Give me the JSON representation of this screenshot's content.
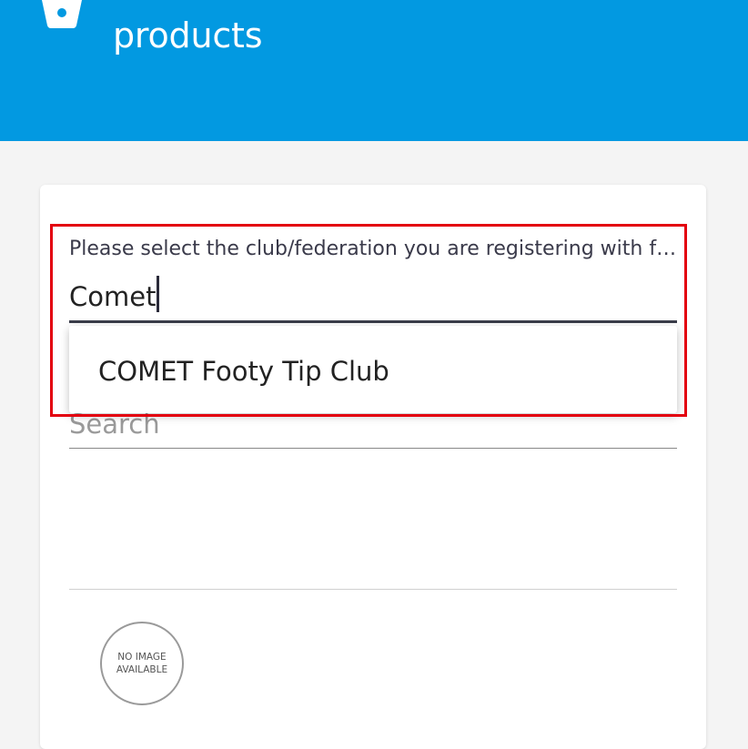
{
  "header": {
    "icon": "basket-icon",
    "title": "products",
    "background_color": "#0299e1"
  },
  "club_select": {
    "label": "Please select the club/federation you are registering with fr...",
    "value": "Comet",
    "options": [
      "COMET Footy Tip Club"
    ]
  },
  "search": {
    "placeholder": "Search"
  },
  "product": {
    "image_placeholder": "NO IMAGE\nAVAILABLE"
  },
  "colors": {
    "highlight": "#e3000f",
    "page_background": "#f4f4f4"
  }
}
